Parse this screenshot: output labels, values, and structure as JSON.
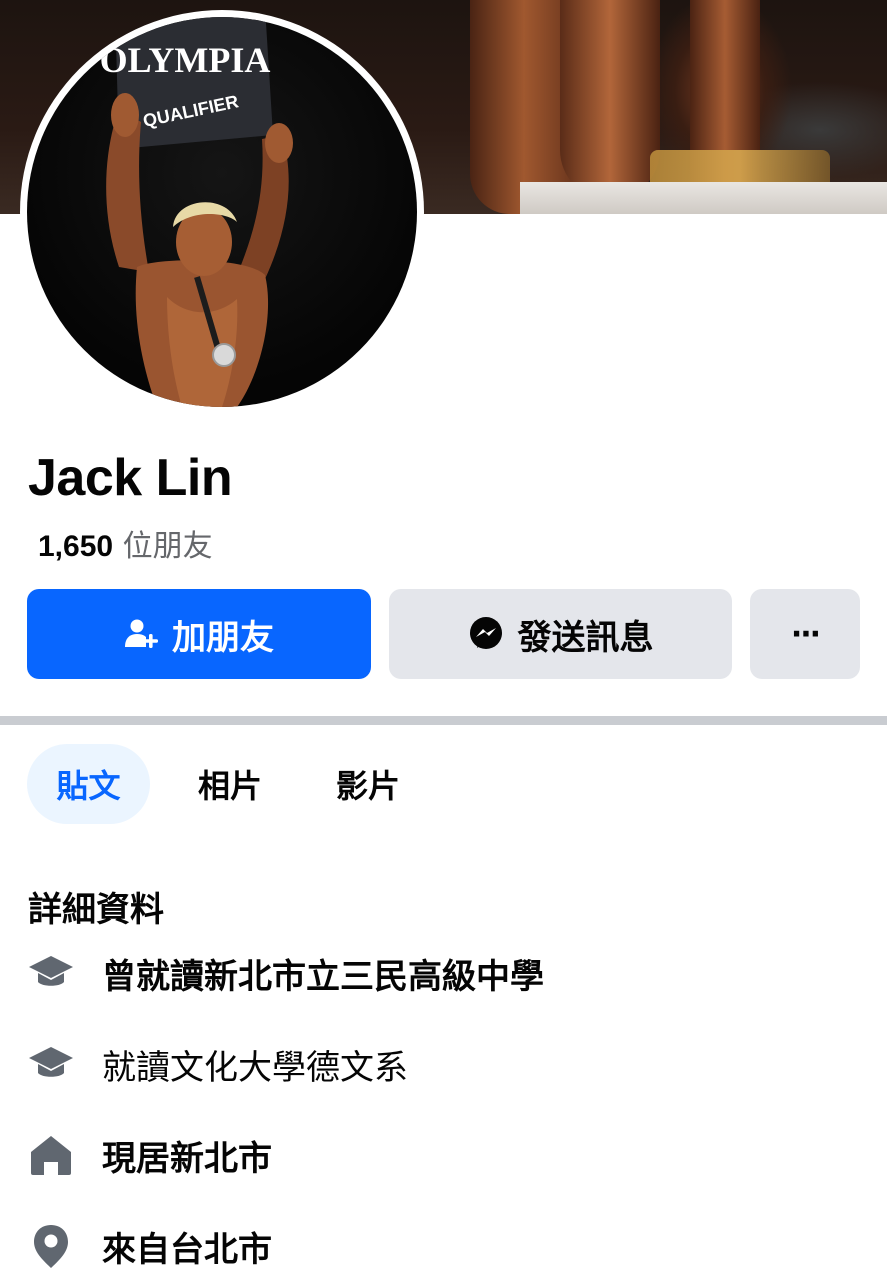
{
  "profile": {
    "name": "Jack Lin",
    "friend_count": "1,650",
    "friend_suffix": " 位朋友"
  },
  "avatar_sign": {
    "line1": "OLYMPIA",
    "line2": "QUALIFIER"
  },
  "actions": {
    "add_friend_label": "加朋友",
    "message_label": "發送訊息",
    "more_label": "···"
  },
  "tabs": [
    {
      "label": "貼文",
      "active": true
    },
    {
      "label": "相片",
      "active": false
    },
    {
      "label": "影片",
      "active": false
    }
  ],
  "details": {
    "title": "詳細資料",
    "items": [
      {
        "icon": "graduation-cap-icon",
        "text": "曾就讀新北市立三民高級中學"
      },
      {
        "icon": "graduation-cap-icon",
        "text": "就讀文化大學德文系"
      },
      {
        "icon": "home-icon",
        "text": "現居新北市"
      },
      {
        "icon": "location-pin-icon",
        "text": "來自台北市"
      }
    ]
  },
  "colors": {
    "primary_blue": "#0866ff",
    "secondary_button": "#e4e6eb",
    "muted_text": "#65676b",
    "active_tab_bg": "#ebf5ff",
    "icon_gray": "#606770"
  }
}
